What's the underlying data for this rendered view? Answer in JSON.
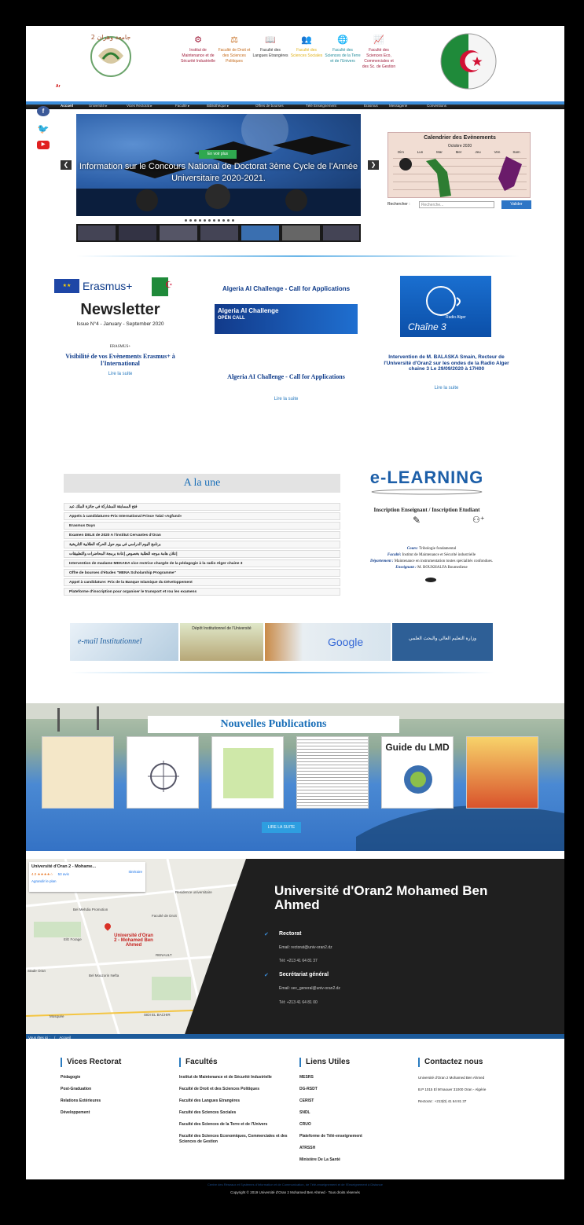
{
  "header": {
    "lang": "Ar",
    "faculties": [
      {
        "label": "Institut de Maintenance et de Sécurité Industrielle",
        "color": "#a01c3a",
        "icon": "gears-icon"
      },
      {
        "label": "Faculté de Droit et des Sciences Politiques",
        "color": "#c56a1a",
        "icon": "scales-icon"
      },
      {
        "label": "Faculté des Langues Etrangères",
        "color": "#333333",
        "icon": "books-icon"
      },
      {
        "label": "Faculté des Sciences Sociales",
        "color": "#e0b21a",
        "icon": "people-icon"
      },
      {
        "label": "Faculté des Sciences de la Terre et de l'Univers",
        "color": "#1f8a9a",
        "icon": "globe-icon"
      },
      {
        "label": "Faculté des Sciences Eco, Commerciales et des Sc. de Gestion",
        "color": "#a01c3a",
        "icon": "chart-icon"
      }
    ]
  },
  "nav": {
    "items": [
      "Accueil",
      "Université ▸",
      "Vices Rectorat ▸",
      "Faculté ▸",
      "Bibliothèque ▸",
      "Offres de bourses",
      "Télé Enseignement",
      "Erasmus",
      "Messagerie",
      "Conventions"
    ]
  },
  "slider": {
    "button": "En voir plus",
    "caption": "Information sur le Concours National de Doctorat 3ème Cycle de l'Année Universitaire 2020-2021."
  },
  "calendar": {
    "title": "Calendrier des Evènements",
    "month": "Octobre 2020",
    "days": [
      "Dim",
      "Lun",
      "Mar",
      "Mer",
      "Jeu",
      "Ven",
      "Sam"
    ],
    "search_label": "Rechercher :",
    "search_placeholder": "Recherche...",
    "search_button": "Valider"
  },
  "news": [
    {
      "banner_erasmus": "Erasmus+",
      "banner_title": "Newsletter",
      "banner_sub": "Issue N°4 - January - September 2020",
      "tag": "ERASMUS+",
      "title": "Visibilité de vos Evènements Erasmus+ à l'International",
      "link": "Lire la suite"
    },
    {
      "head": "Algeria AI Challenge - Call for Applications",
      "banner_title": "Algeria AI Challenge",
      "banner_sub": "OPEN CALL",
      "title": "Algeria AI Challenge - Call for Applications",
      "link": "Lire la suite"
    },
    {
      "banner_sub": "Radio Alger",
      "banner_title": "Chaîne 3",
      "title": "Intervention de M. BALASKA Smain, Recteur de l'Université d'Oran2 sur les ondes de la Radio Alger chaine 3 Le 29/09/2020 à 17H00",
      "link": "Lire la suite"
    }
  ],
  "une": {
    "title": "A la une",
    "items": [
      "فتح المسابقة للمشاركة في جائزة الملك عبد",
      "Appels à candidatures-Prix International Prince Talal «Agfund»",
      "Erasmus Days",
      "Examen DELE de 2020 A l'institut Cervantes d'Oran",
      "برنامج اليوم الدراسي في يوم حول الحركة الطلابية التاريخية",
      "إعلان هامة موجه للطلبة بخصوص إعادة برمجة المحاضرات والتطبيقات",
      "Intervention de madame MEKADA vice rectrice chargée de la pédagogie à la radio Alger chaine 3",
      "Offre de bourses d'études \"MENA Scholarship Programme\"",
      "Appel à candidature: Prix de la Banque Islamique du Développement",
      "Plateforme d'inscription pour organiser le transport et rou les examens"
    ]
  },
  "elearning": {
    "title": "e-LEARNING",
    "inscription": "Inscription Enseignant / Inscription Etudiant",
    "cours_label": "Cours:",
    "cours_value": "Tribologie fondamental",
    "faculte_label": "Faculté:",
    "faculte_value": "Institut de Maintenance et Sécurité industrielle",
    "dept_label": "Département :",
    "dept_value": "Maintenance en instrumentation toutes spécialités confondues.",
    "ens_label": "Enseignant :",
    "ens_value": "M. BOUKHALFA Boumediene"
  },
  "banners": [
    {
      "label": "e-mail Institutionnel"
    },
    {
      "label": "Dépôt Institutionnel de l'Université"
    },
    {
      "label": "Google"
    },
    {
      "label": "وزارة التعليم العالي والبحث العلمي"
    }
  ],
  "publications": {
    "title": "Nouvelles Publications",
    "lmd": "Guide du LMD",
    "button": "LIRE LA SUITE"
  },
  "contact": {
    "map_title": "Université d'Oran 2 - Mohame...",
    "map_directions": "Itinéraire",
    "map_rating": "4.0 ★★★★☆",
    "map_reviews": "53 avis",
    "map_enlarge": "Agrandir le plan",
    "map_labels": [
      "Residence universitaire",
      "Bel Mehdia Promotion",
      "Faculté de Droit",
      "Université d'Oran 2 - Mohamed Ben Ahmed",
      "E/E Forage",
      "RENAULT",
      "Stade Oran",
      "Bel Mouzorin Nefta",
      "SIDI EL BACHIR",
      "Mosquée"
    ],
    "university_name": "Université d'Oran2 Mohamed Ben Ahmed",
    "rectorat_title": "Rectorat",
    "rectorat_email": "Email: rectorat@univ-oran2.dz",
    "rectorat_tel": "Tél: +213 41 64 81 37",
    "sg_title": "Secrétariat général",
    "sg_email": "Email: sec_general@univ-oran2.dz",
    "sg_tel": "Tél: +213 41 64 81 00"
  },
  "breadcrumb": {
    "label": "Vous êtes ici :",
    "sep": "/",
    "current": "Accueil"
  },
  "footer": {
    "vices": {
      "title": "Vices Rectorat",
      "items": [
        "Pédagogie",
        "Post-Graduation",
        "Relations Extérieures",
        "Développement"
      ]
    },
    "facultes": {
      "title": "Facultés",
      "items": [
        "Institut de Maintenance et de Sécurité Industrielle",
        "Faculté de Droit et des Sciences Politiques",
        "Faculté des Langues Etrangères",
        "Faculté des Sciences Sociales",
        "Faculté des Sciences de la Terre et de l'Univers",
        "Faculté des Sciences Economiques, Commerciales et des Sciences de Gestion"
      ]
    },
    "liens": {
      "title": "Liens Utiles",
      "items": [
        "MESRS",
        "DG-RSDT",
        "CERIST",
        "SNDL",
        "CRUO",
        "Plateforme de Télé-enseignement",
        "ATRSSH",
        "Ministère De La Santé"
      ]
    },
    "contact": {
      "title": "Contactez nous",
      "items": [
        "Université d'Oran 2 Mohamed Ben Ahmed",
        "B.P 1015 El M'naouer 31000 Oran - Algérie",
        "Rectorat : +213(0) 41 64 81 37"
      ]
    },
    "credits": "Centre des Réseaux et Systèmes d'Information et de Communication, de Télé-enseignement et de l'Enseignement à Distance",
    "copyright": "Copyright © 2019 Université d'Oran 2 Mohamed Ben Ahmed · Tous droits réservés"
  }
}
